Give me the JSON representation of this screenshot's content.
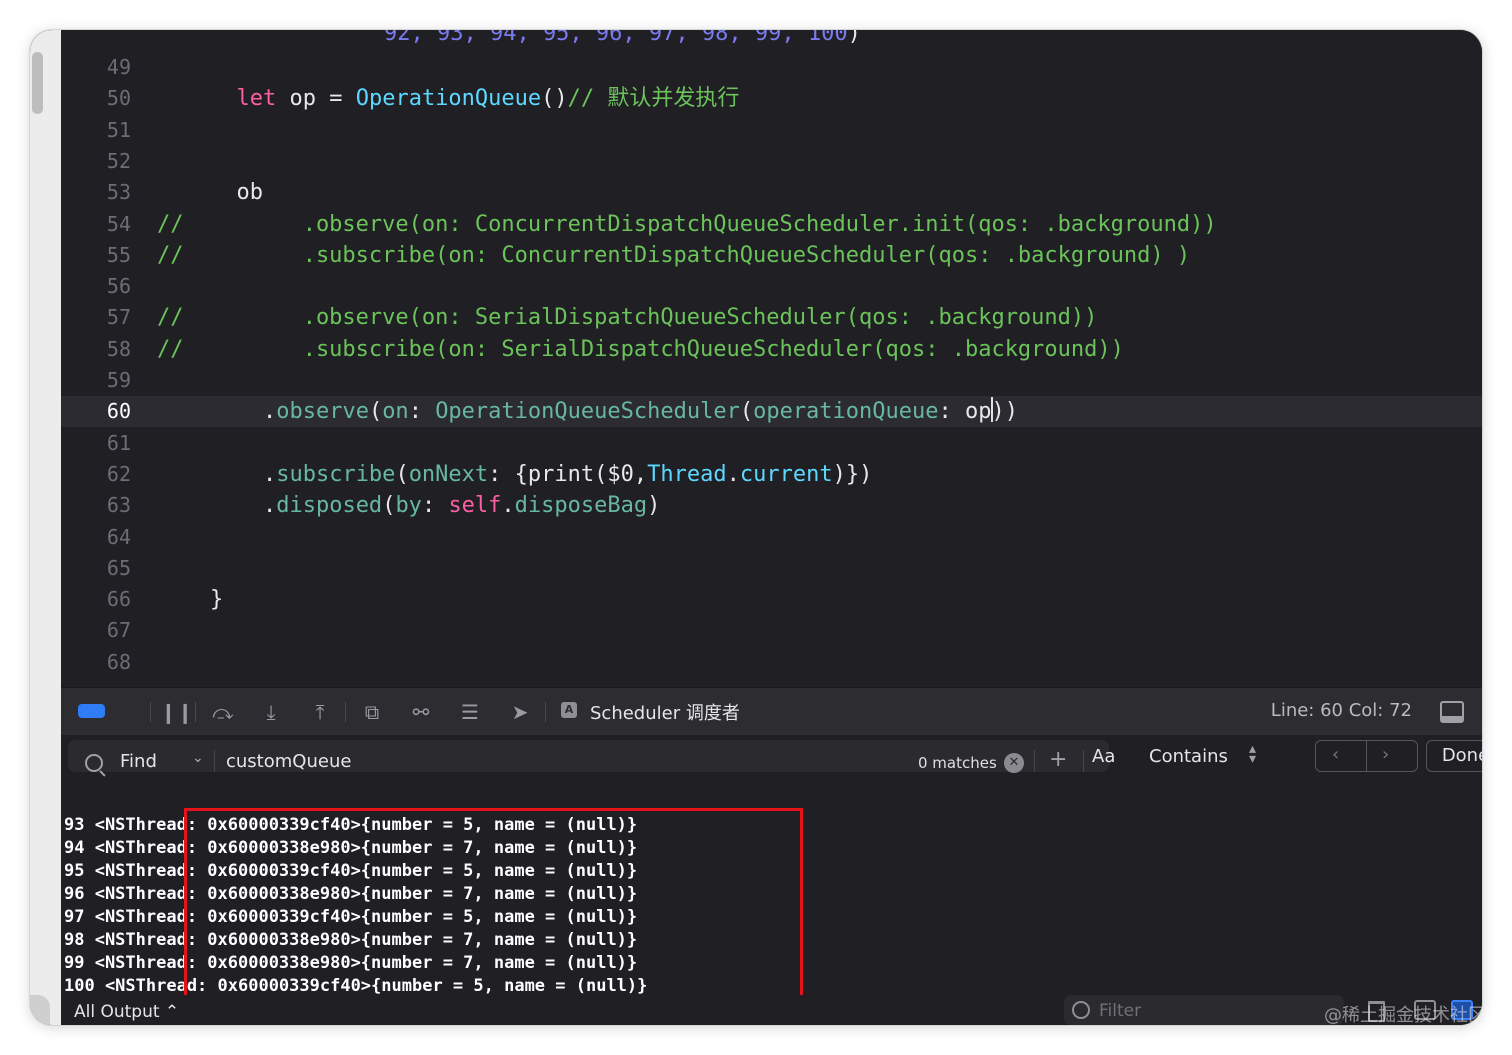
{
  "editor": {
    "top_partial": [
      {
        "c": "t-blue",
        "t": "92, 93, 94, 95, 96, 97, 98, 99, 100"
      },
      {
        "c": "t-plain",
        "t": ")"
      }
    ],
    "lines": [
      {
        "num": "49",
        "indent": "",
        "tokens": []
      },
      {
        "num": "50",
        "indent": "      ",
        "tokens": [
          {
            "c": "t-kw",
            "t": "let"
          },
          {
            "c": "t-plain",
            "t": " op = "
          },
          {
            "c": "t-type",
            "t": "OperationQueue"
          },
          {
            "c": "t-plain",
            "t": "()"
          },
          {
            "c": "t-cmt",
            "t": "// 默认并发执行"
          }
        ]
      },
      {
        "num": "51",
        "indent": "",
        "tokens": []
      },
      {
        "num": "52",
        "indent": "",
        "tokens": []
      },
      {
        "num": "53",
        "indent": "      ",
        "tokens": [
          {
            "c": "t-plain",
            "t": "ob"
          }
        ]
      },
      {
        "num": "54",
        "indent": "",
        "tokens": [
          {
            "c": "t-cmt",
            "t": "//         .observe(on: ConcurrentDispatchQueueScheduler.init(qos: .background))"
          }
        ]
      },
      {
        "num": "55",
        "indent": "",
        "tokens": [
          {
            "c": "t-cmt",
            "t": "//         .subscribe(on: ConcurrentDispatchQueueScheduler(qos: .background) )"
          }
        ]
      },
      {
        "num": "56",
        "indent": "",
        "tokens": []
      },
      {
        "num": "57",
        "indent": "",
        "tokens": [
          {
            "c": "t-cmt",
            "t": "//         .observe(on: SerialDispatchQueueScheduler(qos: .background))"
          }
        ]
      },
      {
        "num": "58",
        "indent": "",
        "tokens": [
          {
            "c": "t-cmt",
            "t": "//         .subscribe(on: SerialDispatchQueueScheduler(qos: .background))"
          }
        ]
      },
      {
        "num": "59",
        "indent": "",
        "tokens": []
      },
      {
        "num": "60",
        "indent": "        ",
        "current": true,
        "tokens": [
          {
            "c": "t-plain",
            "t": "."
          },
          {
            "c": "t-func",
            "t": "observe"
          },
          {
            "c": "t-plain",
            "t": "("
          },
          {
            "c": "t-func",
            "t": "on"
          },
          {
            "c": "t-plain",
            "t": ": "
          },
          {
            "c": "t-func",
            "t": "OperationQueueScheduler"
          },
          {
            "c": "t-plain",
            "t": "("
          },
          {
            "c": "t-func",
            "t": "operationQueue"
          },
          {
            "c": "t-plain",
            "t": ": op"
          },
          {
            "caret": true
          },
          {
            "c": "t-plain",
            "t": "))"
          }
        ]
      },
      {
        "num": "61",
        "indent": "",
        "tokens": []
      },
      {
        "num": "62",
        "indent": "        ",
        "tokens": [
          {
            "c": "t-plain",
            "t": "."
          },
          {
            "c": "t-func",
            "t": "subscribe"
          },
          {
            "c": "t-plain",
            "t": "("
          },
          {
            "c": "t-func",
            "t": "onNext"
          },
          {
            "c": "t-plain",
            "t": ": {print($0,"
          },
          {
            "c": "t-type",
            "t": "Thread"
          },
          {
            "c": "t-plain",
            "t": "."
          },
          {
            "c": "t-type",
            "t": "current"
          },
          {
            "c": "t-plain",
            "t": ")})"
          }
        ]
      },
      {
        "num": "63",
        "indent": "        ",
        "tokens": [
          {
            "c": "t-plain",
            "t": "."
          },
          {
            "c": "t-func",
            "t": "disposed"
          },
          {
            "c": "t-plain",
            "t": "("
          },
          {
            "c": "t-func",
            "t": "by"
          },
          {
            "c": "t-plain",
            "t": ": "
          },
          {
            "c": "t-kw",
            "t": "self"
          },
          {
            "c": "t-plain",
            "t": "."
          },
          {
            "c": "t-func",
            "t": "disposeBag"
          },
          {
            "c": "t-plain",
            "t": ")"
          }
        ]
      },
      {
        "num": "64",
        "indent": "",
        "tokens": []
      },
      {
        "num": "65",
        "indent": "",
        "tokens": []
      },
      {
        "num": "66",
        "indent": "    ",
        "tokens": [
          {
            "c": "t-plain",
            "t": "}"
          }
        ]
      },
      {
        "num": "67",
        "indent": "",
        "tokens": []
      },
      {
        "num": "68",
        "indent": "",
        "tokens": []
      }
    ]
  },
  "debugbar": {
    "icons": [
      "breakpoints-icon",
      "pause-icon",
      "step-over-icon",
      "step-into-icon",
      "step-out-icon",
      "view-hierarchy-icon",
      "memory-graph-icon",
      "environment-overrides-icon",
      "location-icon"
    ],
    "scheme_label": "Scheduler 调度者",
    "line_col": "Line: 60  Col: 72"
  },
  "find": {
    "mode": "Find",
    "query": "customQueue",
    "matches": "0 matches",
    "case_button": "Aa",
    "match_type": "Contains",
    "done_label": "Done"
  },
  "console": {
    "lines": [
      "93 <NSThread: 0x60000339cf40>{number = 5, name = (null)}",
      "94 <NSThread: 0x60000338e980>{number = 7, name = (null)}",
      "95 <NSThread: 0x60000339cf40>{number = 5, name = (null)}",
      "96 <NSThread: 0x60000338e980>{number = 7, name = (null)}",
      "97 <NSThread: 0x60000339cf40>{number = 5, name = (null)}",
      "98 <NSThread: 0x60000338e980>{number = 7, name = (null)}",
      "99 <NSThread: 0x60000338e980>{number = 7, name = (null)}",
      "100 <NSThread: 0x60000339cf40>{number = 5, name = (null)}"
    ],
    "highlight_color": "#e5141c"
  },
  "bottom": {
    "output_selector": "All Output ⌃",
    "filter_placeholder": "Filter"
  },
  "watermark": "@稀土掘金技术社区",
  "colors": {
    "background": "#1f1f24",
    "keyword": "#fc5fa3",
    "type": "#5dd8ff",
    "function": "#67b7a4",
    "comment": "#6bc35a",
    "number": "#7b7bf0",
    "accent": "#2f7df6"
  }
}
